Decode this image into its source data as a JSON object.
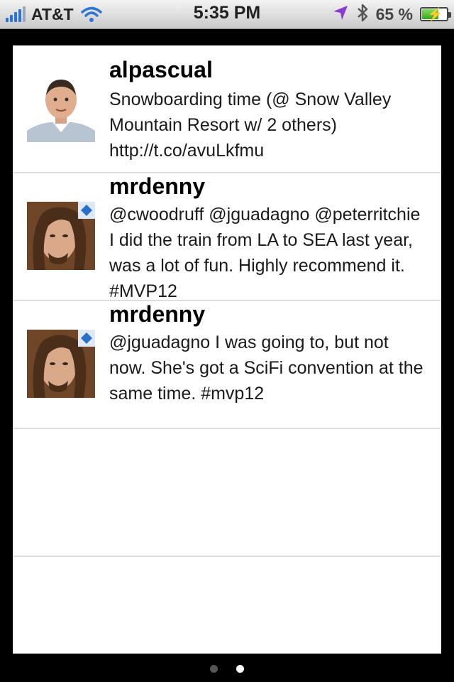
{
  "status_bar": {
    "carrier": "AT&T",
    "time": "5:35 PM",
    "battery_percent": "65 %",
    "icons": [
      "signal-icon",
      "wifi-icon",
      "location-arrow-icon",
      "bluetooth-icon",
      "battery-charging-icon"
    ]
  },
  "tweets": [
    {
      "username": "alpascual",
      "text": "Snowboarding time (@ Snow Valley Mountain Resort w/ 2 others) http://t.co/avuLkfmu"
    },
    {
      "username": "mrdenny",
      "text": "@cwoodruff @jguadagno @peterritchie I did the train from LA to SEA last year, was a lot of fun. Highly recommend it. #MVP12"
    },
    {
      "username": "mrdenny",
      "text": "@jguadagno I was going to, but not now. She's got a SciFi convention at the same time. #mvp12"
    }
  ],
  "pager": {
    "page_count": 2,
    "current_page": 2
  }
}
